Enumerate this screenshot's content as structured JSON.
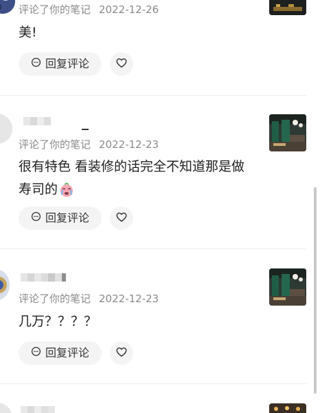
{
  "comments": [
    {
      "action": "评论了你的笔记",
      "date": "2022-12-26",
      "content": "美!",
      "reply_label": "回复评论"
    },
    {
      "action": "评论了你的笔记",
      "date": "2022-12-23",
      "content_line1": "很有特色 看装修的话完全不知道那是做",
      "content_line2": "寿司的",
      "reply_label": "回复评论"
    },
    {
      "action": "评论了你的笔记",
      "date": "2022-12-23",
      "content": "几万？？？？",
      "reply_label": "回复评论"
    }
  ],
  "icons": {
    "reply": "chat-bubble-icon",
    "like": "heart-icon",
    "emoji": "crying-face-emoji"
  },
  "colors": {
    "meta_text": "#8a8a8a",
    "content_text": "#222222",
    "button_bg": "#f4f4f4",
    "divider": "#ececec"
  }
}
